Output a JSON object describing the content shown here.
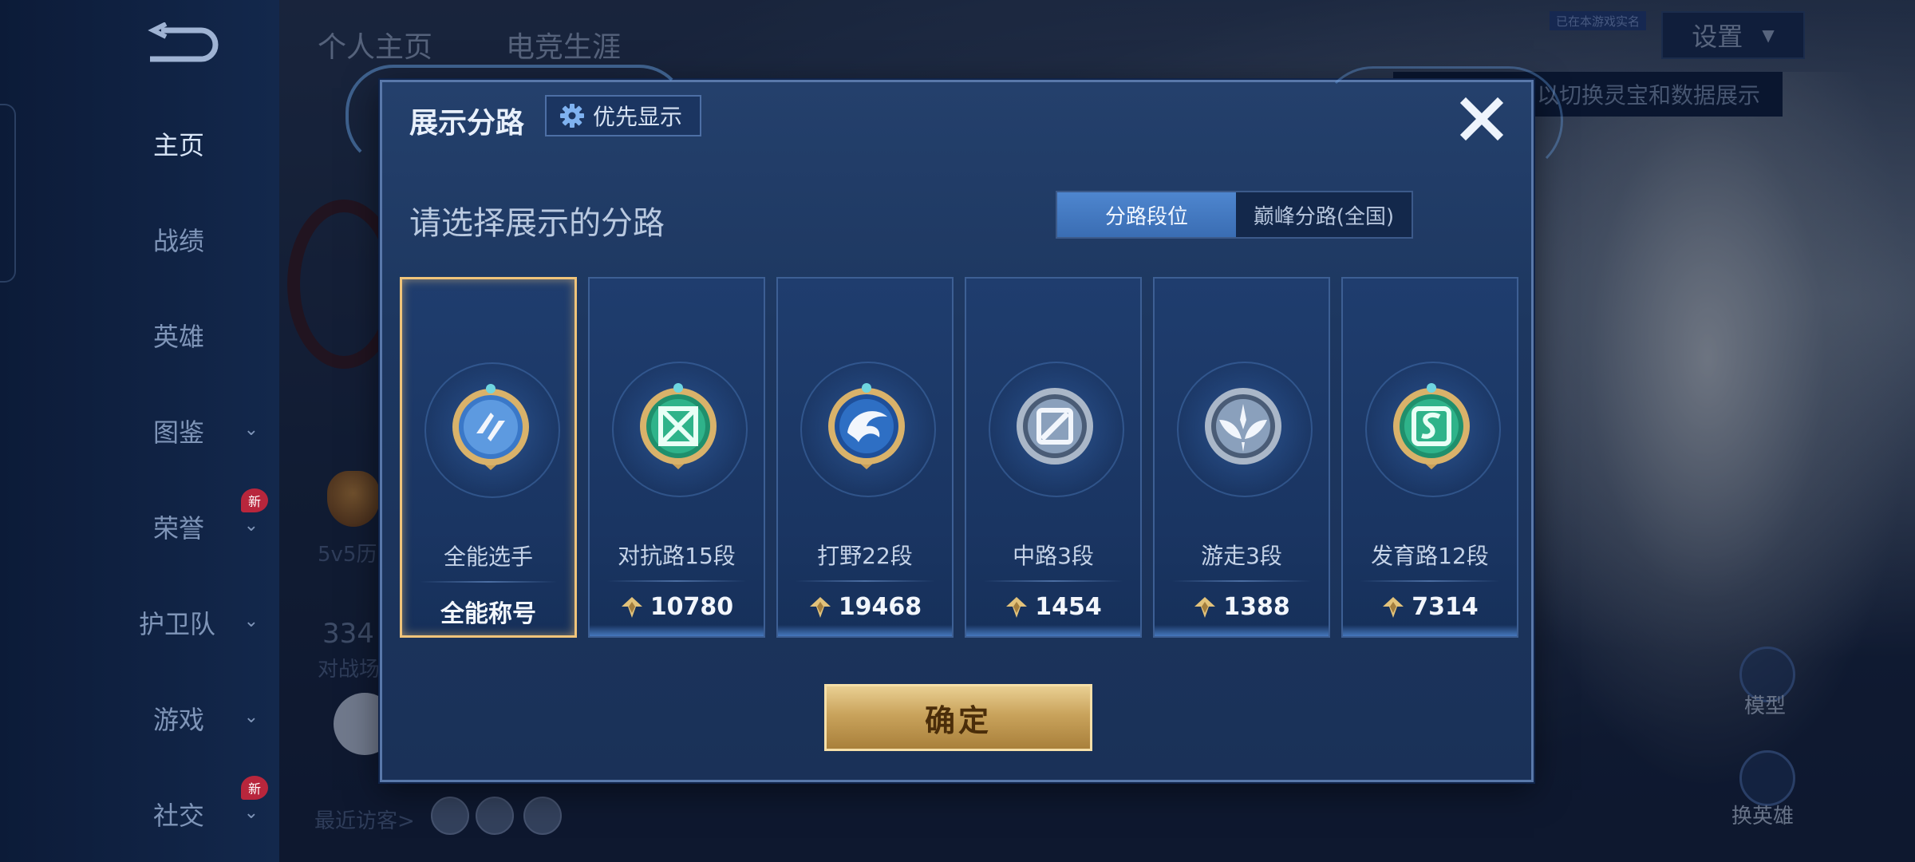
{
  "nav": {
    "items": [
      {
        "label": "主页",
        "active": true
      },
      {
        "label": "战绩"
      },
      {
        "label": "英雄"
      },
      {
        "label": "图鉴"
      },
      {
        "label": "荣誉",
        "badge": "新"
      },
      {
        "label": "护卫队"
      },
      {
        "label": "游戏"
      },
      {
        "label": "社交",
        "badge": "新"
      }
    ]
  },
  "header": {
    "tabs": [
      "个人主页",
      "电竞生涯"
    ],
    "settings_label": "设置",
    "verify_badge": "已在本游戏实名",
    "tip": "以切换灵宝和数据展示"
  },
  "background": {
    "mode_text": "5v5历",
    "count_text": "334",
    "count_label": "对战场",
    "visitors_label": "最近访客>",
    "model_label": "模型",
    "switch_hero_label": "换英雄"
  },
  "modal": {
    "title": "展示分路",
    "pref_button": "优先显示",
    "subtitle": "请选择展示的分路",
    "segment": {
      "active": "分路段位",
      "inactive": "巅峰分路(全国)"
    },
    "confirm": "确定",
    "cards": [
      {
        "name": "全能选手",
        "value": "全能称号",
        "selected": true,
        "icon": "allround-lane-icon",
        "color": "#3a78c8"
      },
      {
        "name": "对抗路15段",
        "value": "10780",
        "icon": "clash-lane-icon",
        "color": "#2fb38a"
      },
      {
        "name": "打野22段",
        "value": "19468",
        "icon": "jungle-lane-icon",
        "color": "#2e6fc4"
      },
      {
        "name": "中路3段",
        "value": "1454",
        "icon": "mid-lane-icon",
        "color": "#8aa0bc"
      },
      {
        "name": "游走3段",
        "value": "1388",
        "icon": "roam-lane-icon",
        "color": "#8aa0bc"
      },
      {
        "name": "发育路12段",
        "value": "7314",
        "icon": "farm-lane-icon",
        "color": "#2fb38a"
      }
    ]
  },
  "colors": {
    "accent_gold": "#f0c47a",
    "panel_blue": "#1d3760",
    "tab_active": "#4e86cf"
  }
}
